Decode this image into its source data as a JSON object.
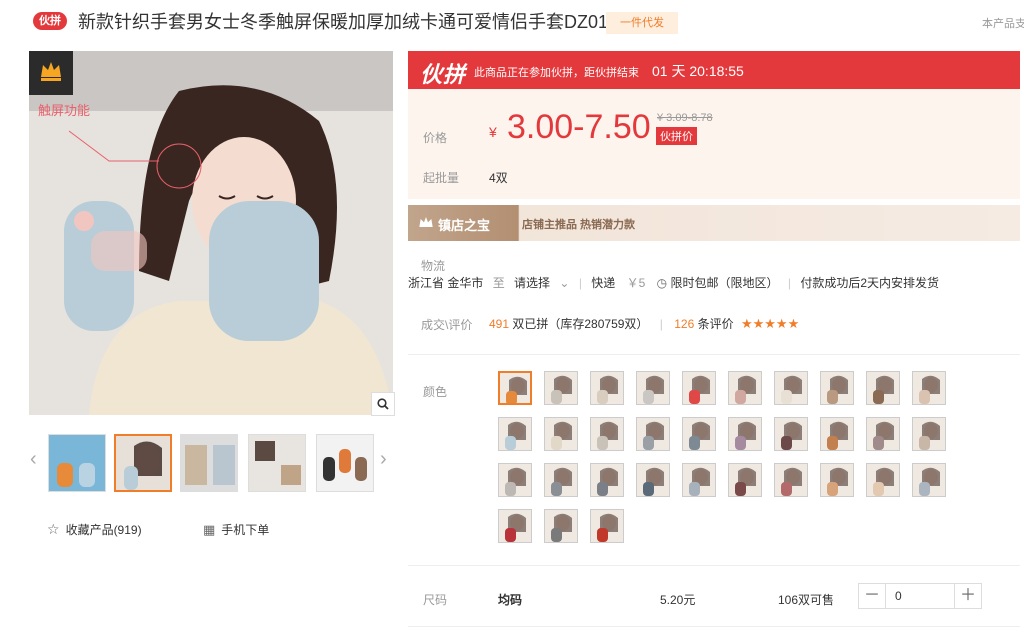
{
  "header": {
    "badge": "伙拼",
    "title": "新款针织手套男女士冬季触屏保暖加厚加绒卡通可爱情侣手套DZ01",
    "dropship_tag": "一件代发",
    "right_text": "本产品支"
  },
  "gallery": {
    "touch_label": "触屏功能",
    "zoom_icon": "search-icon",
    "favorite_label": "收藏产品(919)",
    "mobile_order_label": "手机下单"
  },
  "promo": {
    "logo": "伙拼",
    "text": "此商品正在参加伙拼，距伙拼结束",
    "countdown": "01 天 20:18:55"
  },
  "price": {
    "label": "价格",
    "currency": "¥",
    "value": "3.00-7.50",
    "old_value": "¥ 3.09-8.78",
    "tag": "伙拼价",
    "moq_label": "起批量",
    "moq_value": "4双"
  },
  "shop": {
    "title": "镇店之宝",
    "subtitle": "店铺主推品  热销潜力款"
  },
  "logistics": {
    "label": "物流",
    "origin": "浙江省 金华市",
    "to": "至",
    "dest": "请选择",
    "method": "快递",
    "fee": "￥5",
    "shipping_promo": "限时包邮（限地区）",
    "dispatch": "付款成功后2天内安排发货"
  },
  "stats": {
    "label": "成交\\评价",
    "sold_count": "491",
    "sold_text": "双已拼（库存280759双）",
    "reviews_count": "126",
    "reviews_text": "条评价",
    "stars": "★★★★★"
  },
  "color_label": "颜色",
  "size": {
    "label": "尺码",
    "value": "均码",
    "price": "5.20元",
    "stock": "106双可售",
    "qty": "0",
    "minus": "－",
    "plus": "＋"
  },
  "colors": {
    "accent": "#e4393c",
    "orange": "#f07d2a",
    "star": "#f5a623"
  }
}
